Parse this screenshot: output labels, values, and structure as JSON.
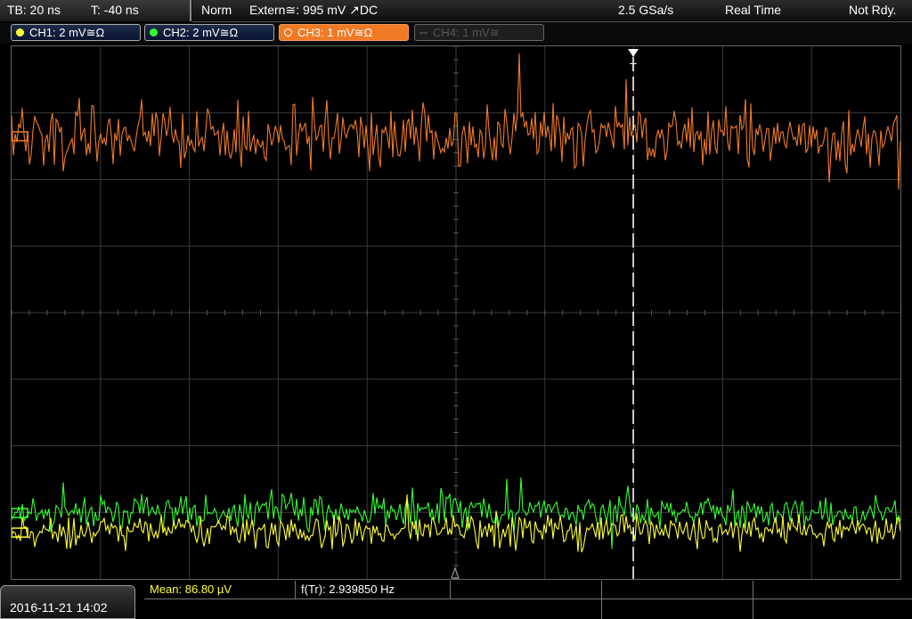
{
  "topbar": {
    "timebase": "TB: 20 ns",
    "trigger_offset": "T: -40 ns",
    "trigger_mode": "Norm",
    "trigger_source": "Extern≅: 995 mV ↗DC",
    "sample_rate": "2.5 GSa/s",
    "acq_mode": "Real Time",
    "status": "Not Rdy."
  },
  "channels": [
    {
      "label": "CH1: 2 mV≅Ω",
      "color": "#ffff33",
      "state": "on"
    },
    {
      "label": "CH2: 2 mV≅Ω",
      "color": "#33ff33",
      "state": "on"
    },
    {
      "label": "CH3: 1 mV≅Ω",
      "color": "#f07a26",
      "state": "selected"
    },
    {
      "label": "CH4: 1 mV≅",
      "color": "#555555",
      "state": "off"
    }
  ],
  "trigger_marker": "T",
  "date": "2016-11-21 14:02",
  "measurements": {
    "mean": "Mean: 86.80 µV",
    "freq": "f(Tr): 2.939850 Hz"
  },
  "colors": {
    "grid": "#3a3a3a",
    "ch1": "#ffff33",
    "ch2": "#33ff33",
    "ch3": "#f07a26"
  }
}
